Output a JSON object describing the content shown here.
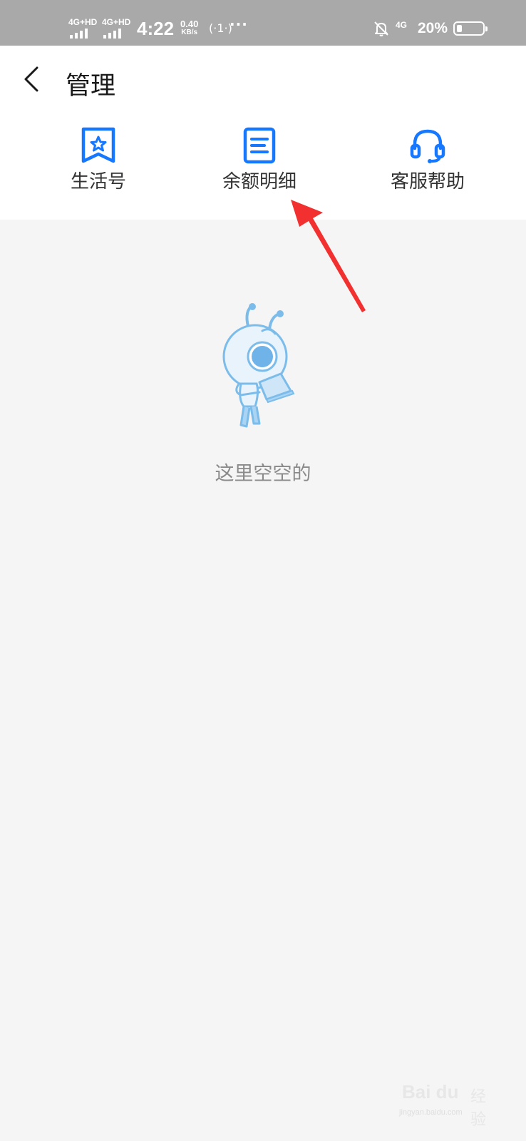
{
  "status_bar": {
    "sim1": "4G+HD",
    "sim2": "4G+HD",
    "time": "4:22",
    "speed_value": "0.40",
    "speed_unit": "KB/s",
    "hotspot_glyph": "(·1·)",
    "more_dots": "···",
    "network": "4G",
    "battery": "20%",
    "battery_level": 0.2,
    "icons": [
      "signal-icon",
      "hotspot-icon",
      "silent-bell-icon",
      "battery-icon"
    ]
  },
  "header": {
    "title": "管理",
    "back_icon": "chevron-left-icon"
  },
  "menu": [
    {
      "label": "生活号",
      "icon": "star-bookmark-icon"
    },
    {
      "label": "余额明细",
      "icon": "document-list-icon"
    },
    {
      "label": "客服帮助",
      "icon": "headset-icon"
    }
  ],
  "empty_state": {
    "text": "这里空空的",
    "illustration": "ant-mascot-icon"
  },
  "watermark": {
    "logo_text": "Bai du",
    "logo_suffix": "经验",
    "url": "jingyan.baidu.com"
  },
  "colors": {
    "accent": "#1677ff",
    "annotation_arrow": "#f23030",
    "mascot": "#7cbcea",
    "background": "#f5f5f6"
  }
}
